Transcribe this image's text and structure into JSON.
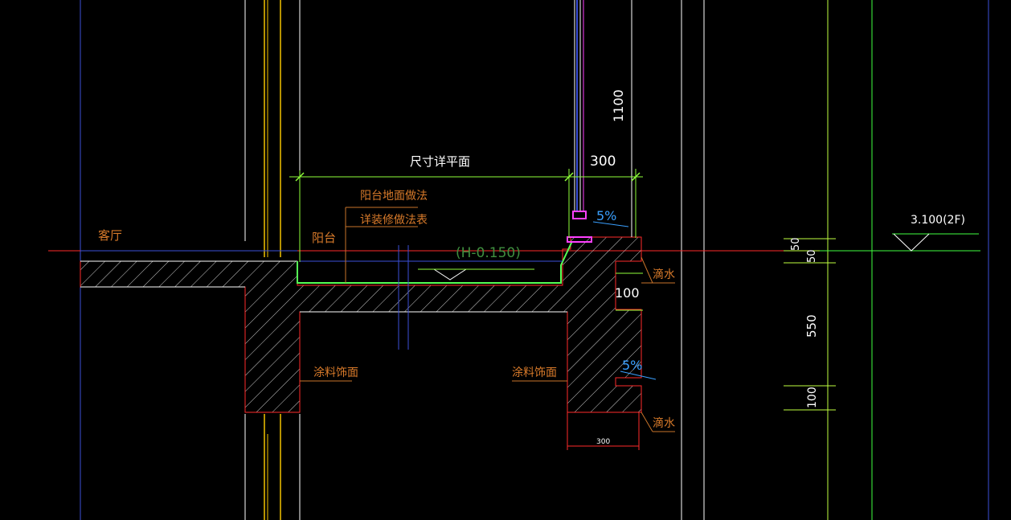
{
  "drawing": {
    "labels": {
      "living_room": "客厅",
      "balcony": "阳台",
      "balcony_floor_method": "阳台地面做法",
      "see_finish_table": "详装修做法表",
      "plan_dim_title": "尺寸详平面",
      "elevation_local": "(H-0.150)",
      "paint_finish_left": "涂料饰面",
      "paint_finish_right": "涂料饰面",
      "drip_upper": "滴水",
      "drip_lower": "滴水",
      "slope_upper": "5%",
      "slope_lower": "5%",
      "floor_elevation": "3.100(2F)"
    },
    "dimensions": {
      "railing_height": "1100",
      "ledge_width": "300",
      "curb_thickness": "100",
      "bottom_width": "300",
      "right_dim_50a": "50",
      "right_dim_50b": "50",
      "right_dim_550": "550",
      "right_dim_100": "100"
    },
    "colors": {
      "background": "#000000",
      "grid_blue": "#3b4fd8",
      "yellow_line": "#f2c300",
      "white_line": "#ffffff",
      "red_line": "#ff2a2a",
      "green_line": "#55ff55",
      "leader_orange": "#c8742a",
      "dim_green": "#8fff3a",
      "text_orange": "#d87a2a",
      "text_white": "#ffffff",
      "slope_blue": "#3aa0ff",
      "cyan_line": "#00e5ff",
      "magenta": "#ff40ff",
      "hatch": "#cfcfcf"
    }
  }
}
